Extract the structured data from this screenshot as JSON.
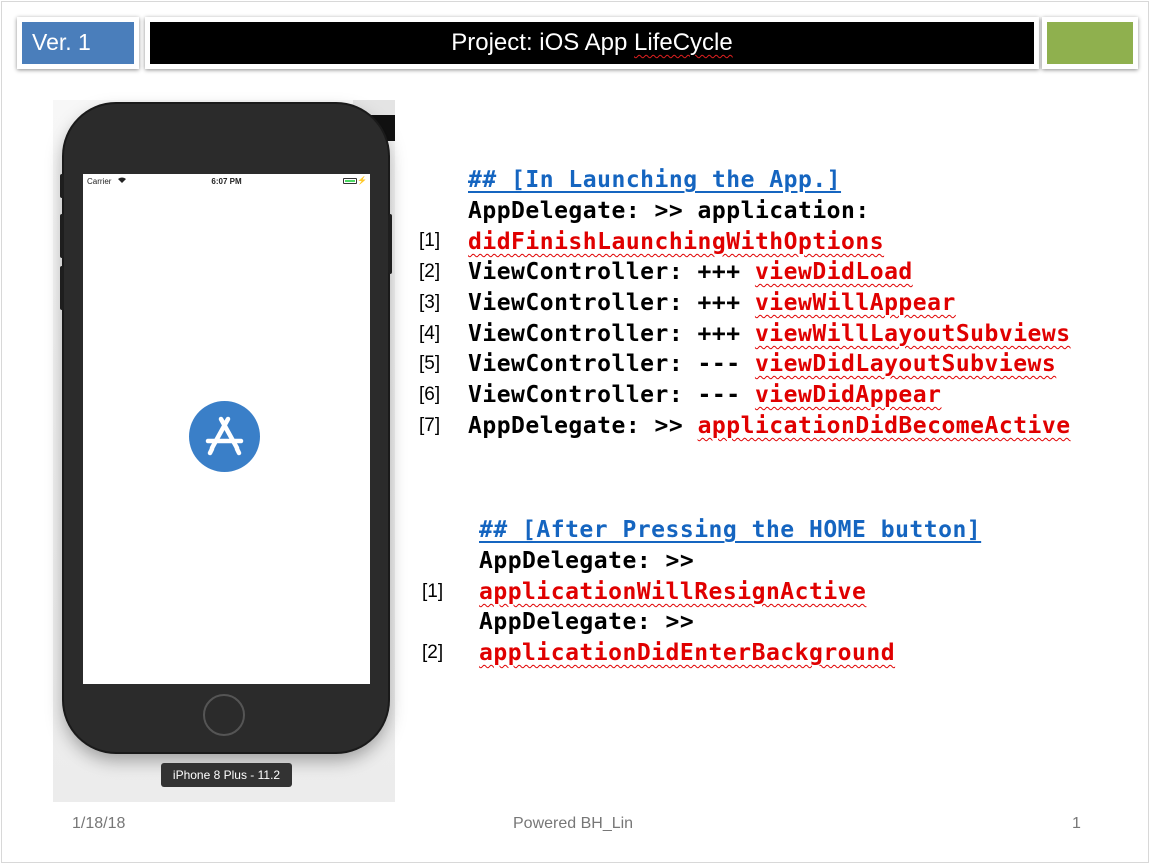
{
  "header": {
    "version_label": "Ver. 1",
    "title_prefix": "Project: iOS App ",
    "title_highlight": "LifeCycle",
    "accent_colors": {
      "version_box": "#4a7ebb",
      "title_box": "#000000",
      "green_box": "#8fb04e"
    }
  },
  "phone": {
    "carrier": "Carrier",
    "time": "6:07 PM",
    "app_icon": "app-store-icon",
    "device_label": "iPhone 8 Plus - 11.2"
  },
  "launch_section": {
    "heading": "## [In Launching the App.]",
    "lines": [
      {
        "num": "",
        "prefix": "AppDelegate: >> application:",
        "method": ""
      },
      {
        "num": "[1]",
        "prefix": "",
        "method": "didFinishLaunchingWithOptions"
      },
      {
        "num": "[2]",
        "prefix": "ViewController: +++ ",
        "method": "viewDidLoad"
      },
      {
        "num": "[3]",
        "prefix": "ViewController: +++ ",
        "method": "viewWillAppear"
      },
      {
        "num": "[4]",
        "prefix": "ViewController: +++ ",
        "method": "viewWillLayoutSubviews"
      },
      {
        "num": "[5]",
        "prefix": "ViewController: --- ",
        "method": "viewDidLayoutSubviews"
      },
      {
        "num": "[6]",
        "prefix": "ViewController: --- ",
        "method": "viewDidAppear"
      },
      {
        "num": "[7]",
        "prefix": "AppDelegate: >> ",
        "method": "applicationDidBecomeActive"
      }
    ]
  },
  "home_section": {
    "heading": "## [After Pressing the HOME button]",
    "lines": [
      {
        "num": "",
        "prefix": "AppDelegate: >>",
        "method": ""
      },
      {
        "num": "[1]",
        "prefix": "",
        "method": "applicationWillResignActive"
      },
      {
        "num": "",
        "prefix": "AppDelegate: >>",
        "method": ""
      },
      {
        "num": "[2]",
        "prefix": "",
        "method": "applicationDidEnterBackground"
      }
    ]
  },
  "footer": {
    "date": "1/18/18",
    "credit": "Powered BH_Lin",
    "page": "1"
  }
}
